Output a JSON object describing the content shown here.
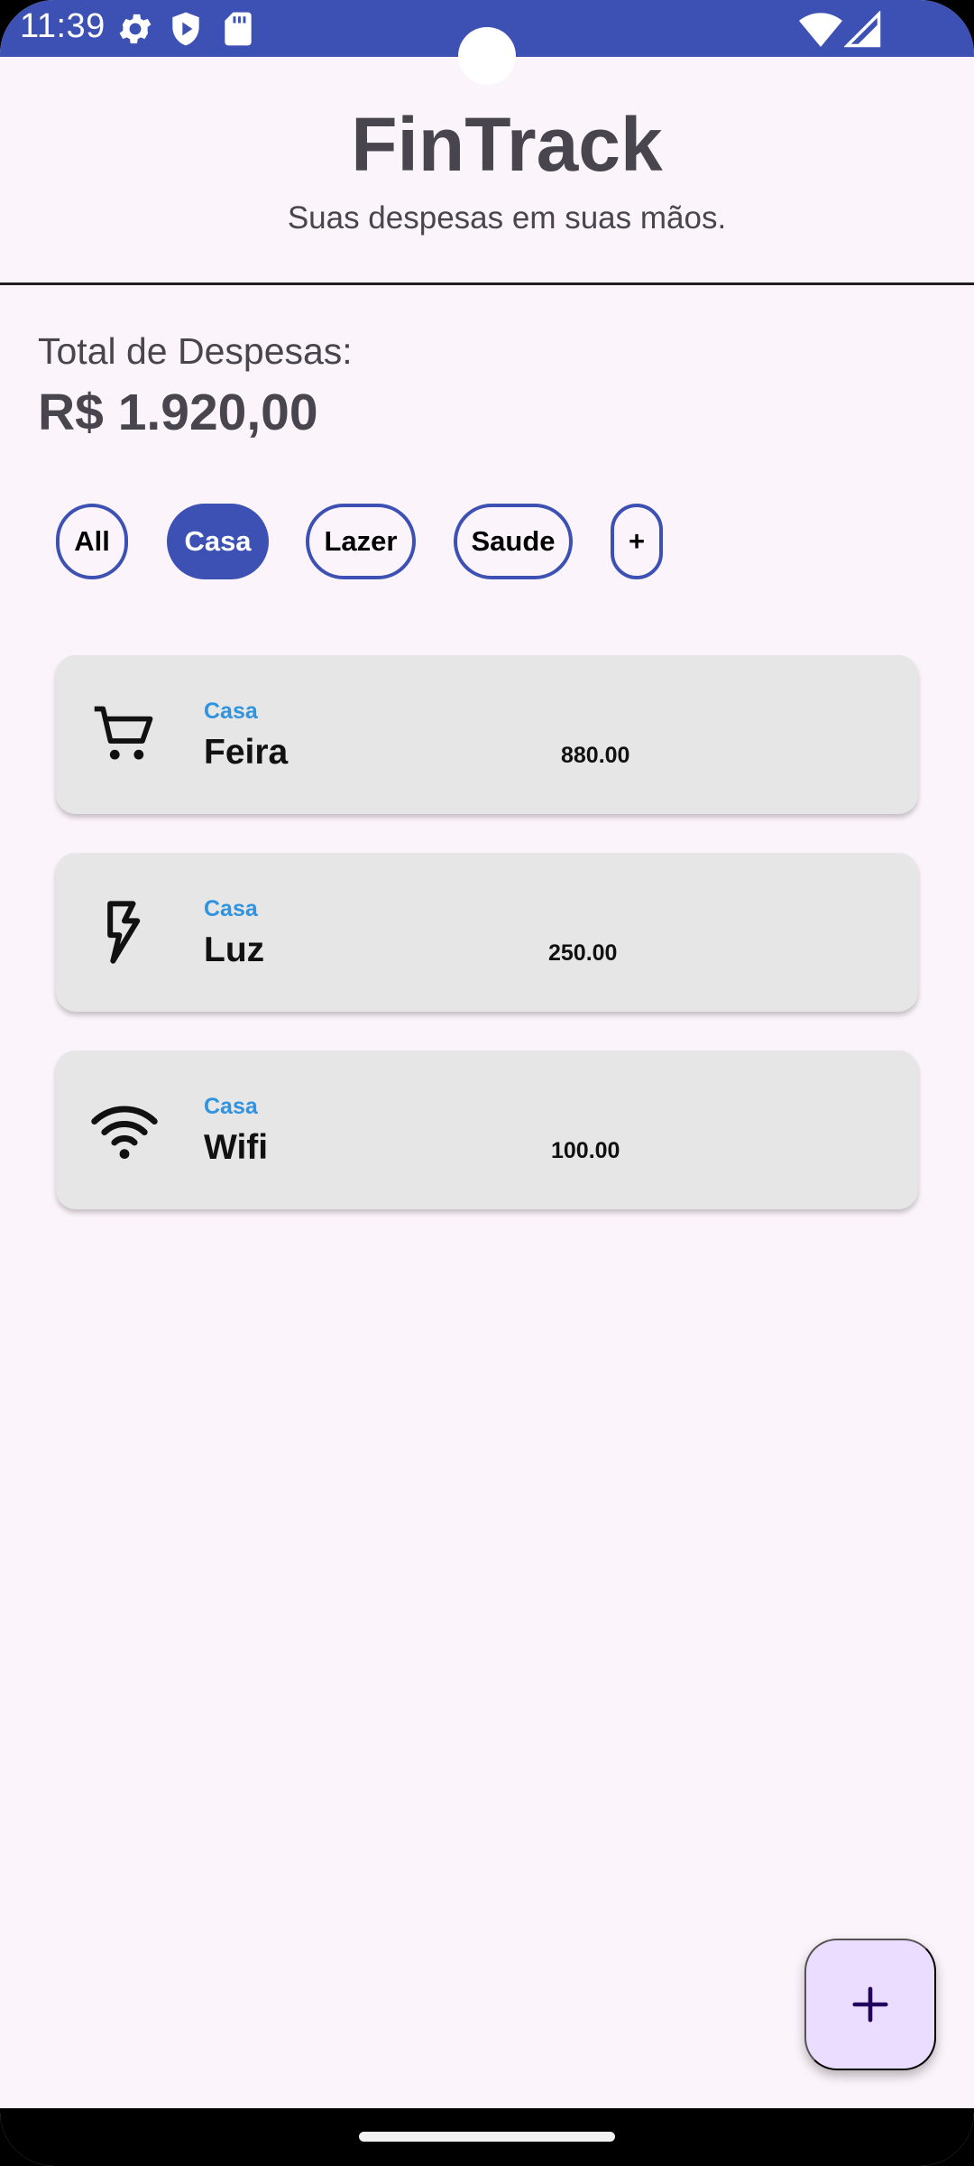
{
  "status_bar": {
    "time": "11:39",
    "icons": [
      "gear-icon",
      "shield-play-icon",
      "sd-card-icon",
      "wifi-icon",
      "signal-icon"
    ],
    "background": "#3d51b4"
  },
  "header": {
    "title": "FinTrack",
    "subtitle": "Suas despesas em suas mãos."
  },
  "total": {
    "label": "Total de Despesas:",
    "value": "R$ 1.920,00"
  },
  "filters": {
    "chips": [
      {
        "label": "All",
        "active": false
      },
      {
        "label": "Casa",
        "active": true
      },
      {
        "label": "Lazer",
        "active": false
      },
      {
        "label": "Saude",
        "active": false
      },
      {
        "label": "+",
        "active": false
      }
    ],
    "accent": "#3d51b4"
  },
  "expenses": [
    {
      "icon": "cart-icon",
      "category": "Casa",
      "name": "Feira",
      "amount": "880.00"
    },
    {
      "icon": "bolt-icon",
      "category": "Casa",
      "name": "Luz",
      "amount": "250.00"
    },
    {
      "icon": "wifi-icon",
      "category": "Casa",
      "name": "Wifi",
      "amount": "100.00"
    }
  ],
  "fab": {
    "icon": "plus-icon",
    "background": "#eaddff"
  },
  "colors": {
    "background": "#fcf4fb",
    "card": "#e6e6e6",
    "category_text": "#2f93e0",
    "title_text": "#48454e"
  }
}
